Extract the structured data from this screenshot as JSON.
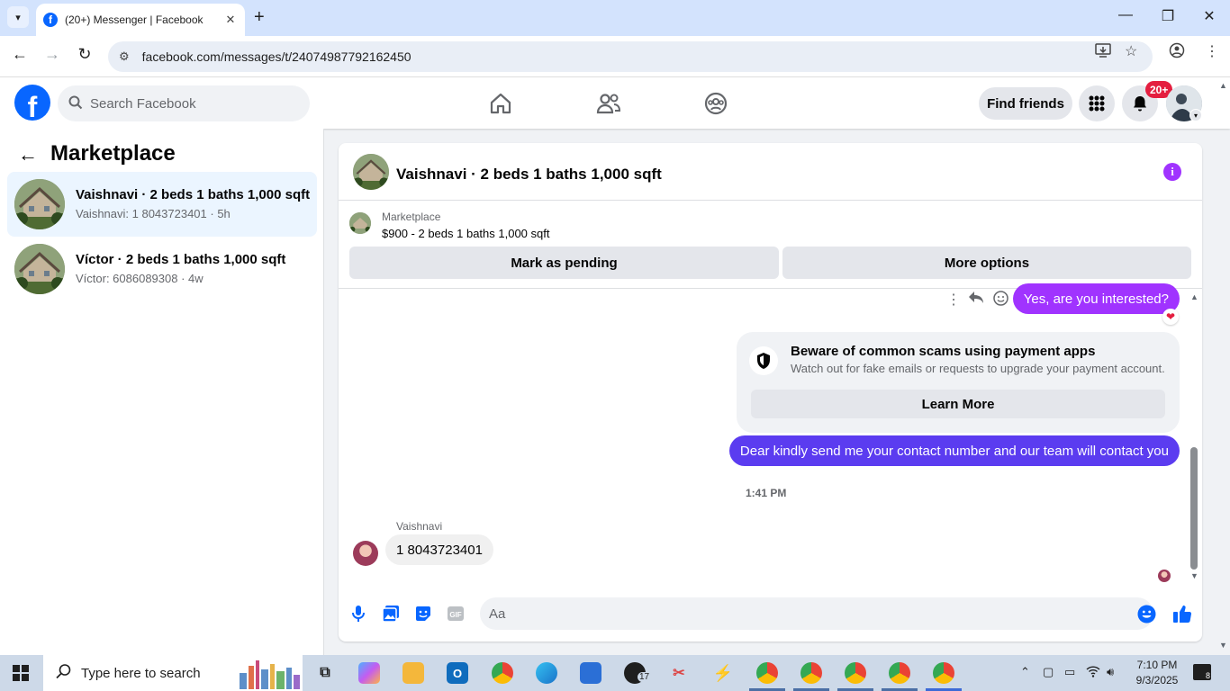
{
  "browser": {
    "tab_title": "(20+) Messenger | Facebook",
    "url": "facebook.com/messages/t/24074987792162450"
  },
  "fb_nav": {
    "search_placeholder": "Search Facebook",
    "find_friends_label": "Find friends",
    "notification_count": "20+"
  },
  "sidebar": {
    "title": "Marketplace",
    "conversations": [
      {
        "name": "Vaishnavi · 2 beds 1 baths 1,000 sqft",
        "snippet": "Vaishnavi: 1 8043723401 · 5h",
        "active": true
      },
      {
        "name": "Víctor · 2 beds 1 baths 1,000 sqft",
        "snippet": "Víctor: 6086089308 · 4w",
        "active": false
      }
    ]
  },
  "chat": {
    "header_name": "Vaishnavi · 2 beds 1 baths 1,000 sqft",
    "listing": {
      "label": "Marketplace",
      "title": "$900 - 2 beds 1 baths 1,000 sqft",
      "mark_pending_label": "Mark as pending",
      "more_options_label": "More options"
    },
    "messages": {
      "out_1": "Yes, are you interested?",
      "scam_title": "Beware of common scams using payment apps",
      "scam_text": "Watch out for fake emails or requests to upgrade your payment account.",
      "scam_button": "Learn More",
      "out_2": "Dear kindly send me your contact number and our team will contact you",
      "timestamp": "1:41 PM",
      "in_sender": "Vaishnavi",
      "in_1": "1 8043723401"
    },
    "composer_placeholder": "Aa"
  },
  "taskbar": {
    "search_placeholder": "Type here to search",
    "whatsapp_badge": "17",
    "time": "7:10 PM",
    "date": "9/3/2025",
    "notification_count": "8"
  },
  "colors": {
    "fb_blue": "#0866ff",
    "bubble_purple": "#a033ff",
    "bubble_indigo": "#5b3cf0",
    "active_conv": "#ebf5ff"
  }
}
